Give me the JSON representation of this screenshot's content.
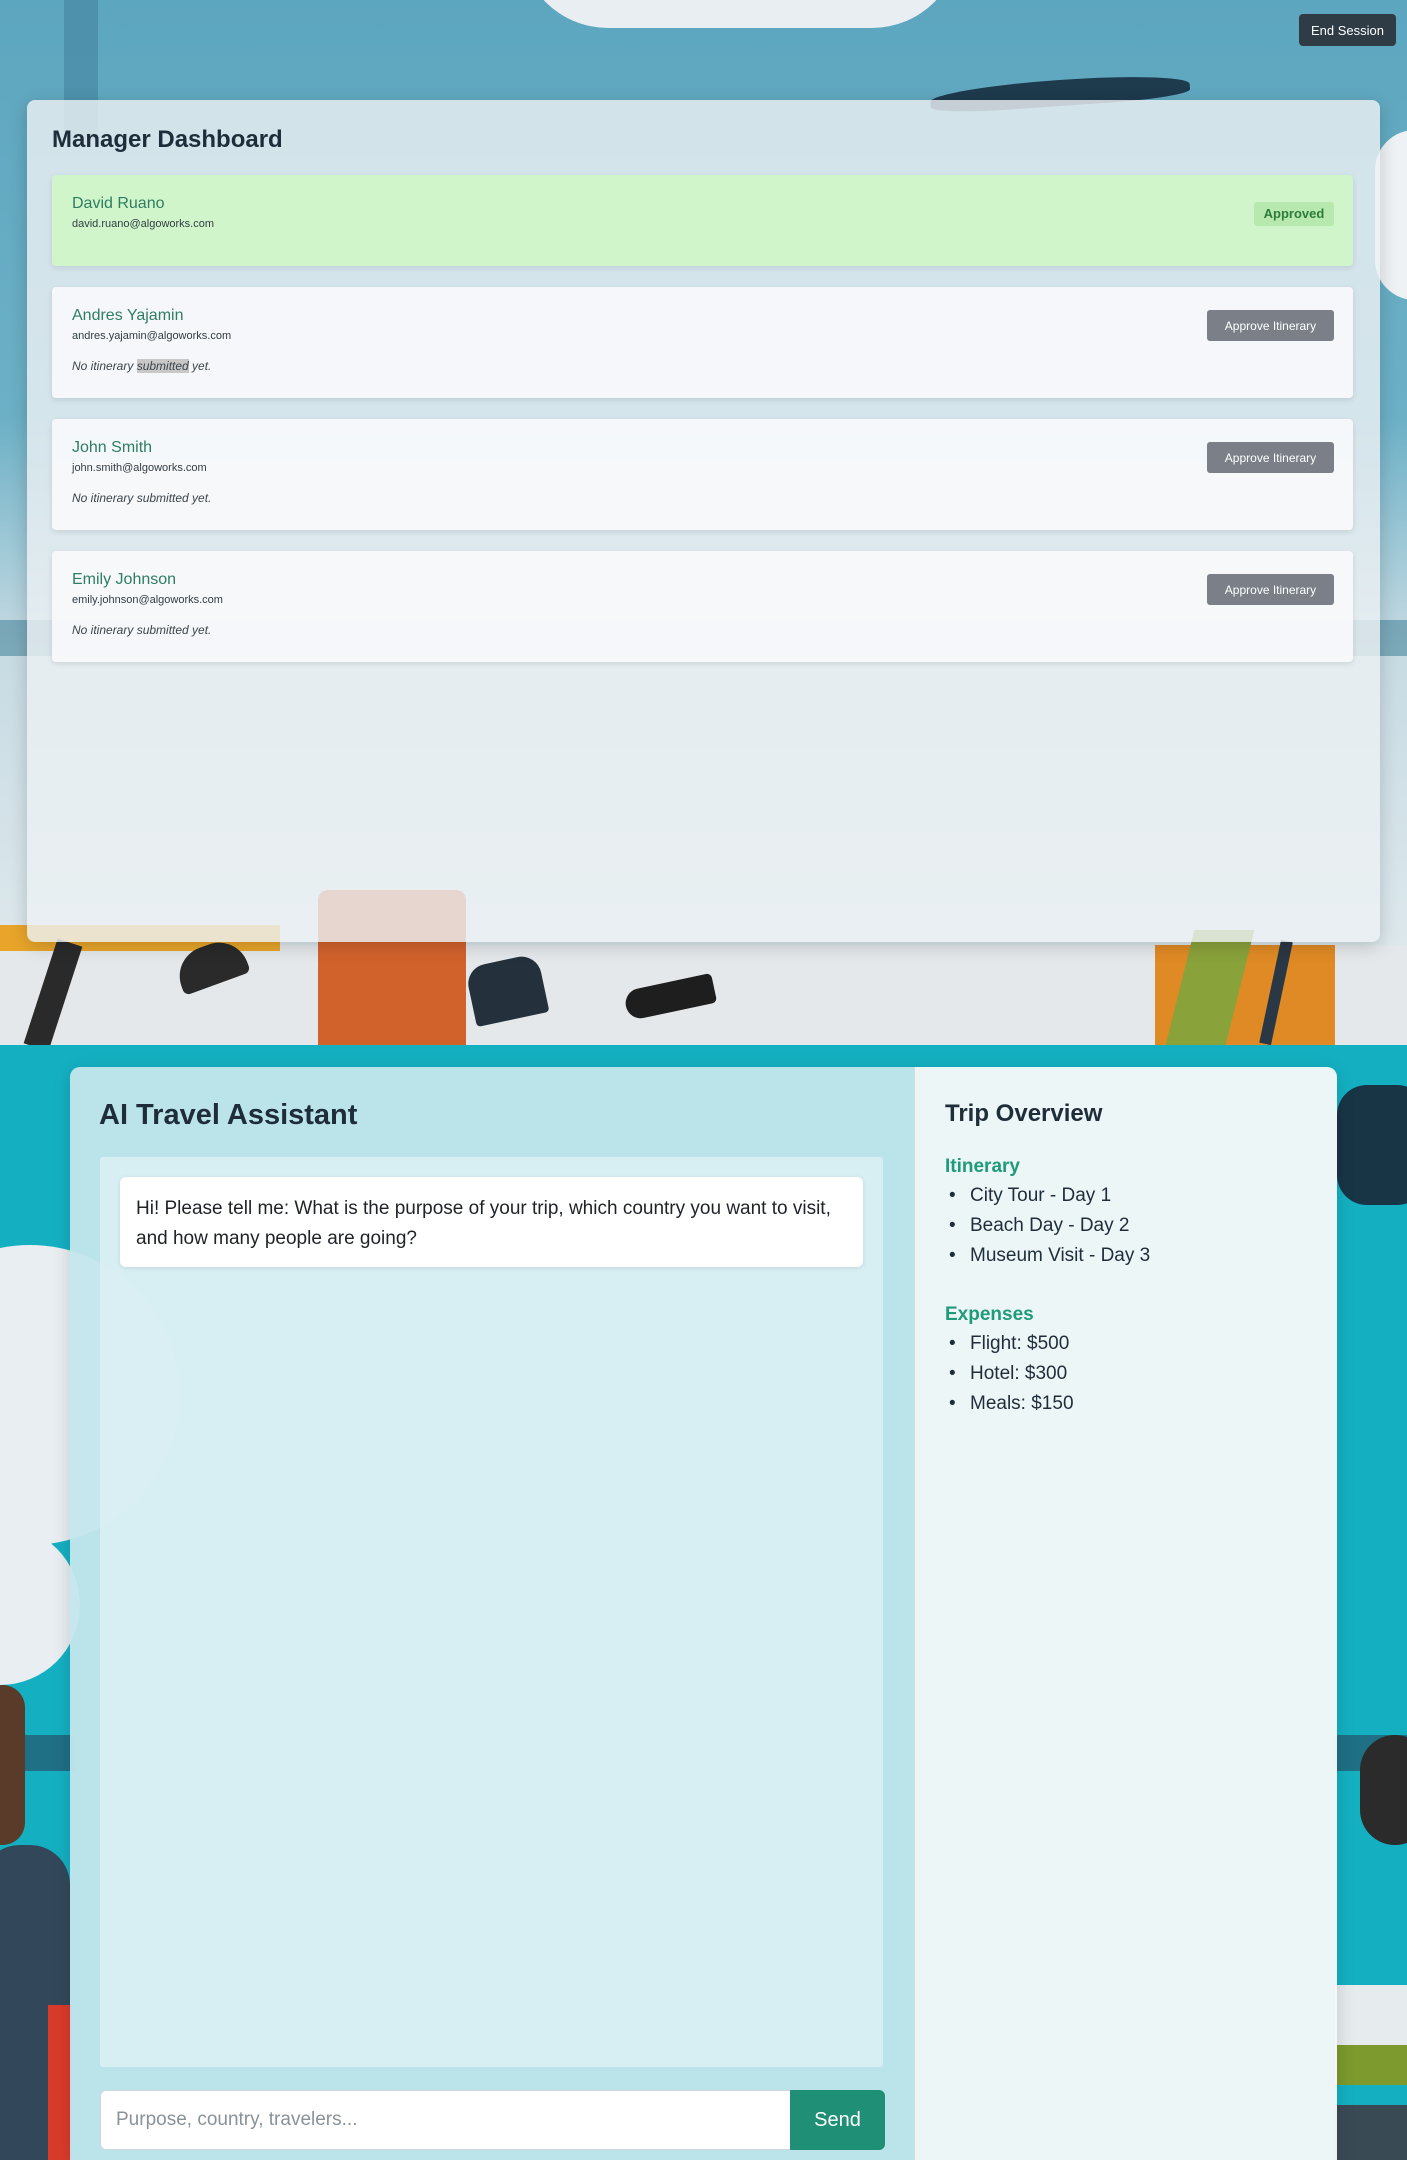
{
  "header": {
    "end_session_label": "End Session"
  },
  "dashboard": {
    "title": "Manager Dashboard",
    "employees": [
      {
        "name": "David Ruano",
        "email": "david.ruano@algoworks.com",
        "status": "Approved",
        "note": ""
      },
      {
        "name": "Andres Yajamin",
        "email": "andres.yajamin@algoworks.com",
        "action_label": "Approve Itinerary",
        "note_before": "No itinerary ",
        "note_highlight": "submitted",
        "note_after": " yet."
      },
      {
        "name": "John Smith",
        "email": "john.smith@algoworks.com",
        "action_label": "Approve Itinerary",
        "note": "No itinerary submitted yet."
      },
      {
        "name": "Emily Johnson",
        "email": "emily.johnson@algoworks.com",
        "action_label": "Approve Itinerary",
        "note": "No itinerary submitted yet."
      }
    ],
    "colors": {
      "approved_bg": "#d0f5c8",
      "name_text": "#2f7d62",
      "approve_button": "#7b8088"
    }
  },
  "assistant": {
    "title": "AI Travel Assistant",
    "messages": [
      {
        "role": "assistant",
        "text": "Hi! Please tell me: What is the purpose of your trip, which country you want to visit, and how many people are going?"
      }
    ],
    "input": {
      "value": "",
      "placeholder": "Purpose, country, travelers..."
    },
    "send_label": "Send",
    "colors": {
      "send_button": "#1f8f75",
      "heading_accent": "#1f9a7a"
    }
  },
  "overview": {
    "title": "Trip Overview",
    "itinerary_heading": "Itinerary",
    "itinerary": [
      "City Tour - Day 1",
      "Beach Day - Day 2",
      "Museum Visit - Day 3"
    ],
    "expenses_heading": "Expenses",
    "expenses": [
      "Flight: $500",
      "Hotel: $300",
      "Meals: $150"
    ]
  }
}
